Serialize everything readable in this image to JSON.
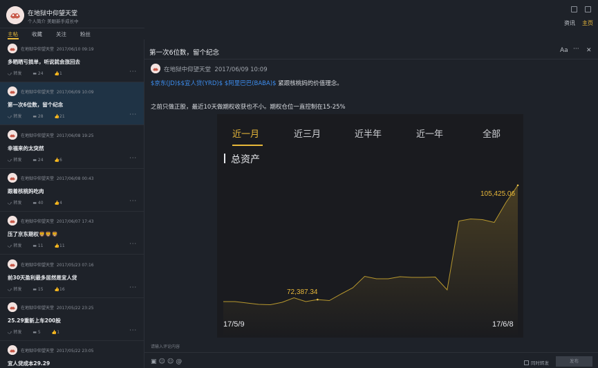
{
  "header": {
    "username": "在地狱中仰望天堂",
    "bio": "个人简介 美眼新手成长中",
    "tabs": [
      {
        "label": "资讯",
        "active": false
      },
      {
        "label": "主页",
        "active": true
      }
    ]
  },
  "nav": {
    "tabs": [
      {
        "label": "主帖",
        "active": true
      },
      {
        "label": "收藏",
        "active": false
      },
      {
        "label": "关注",
        "active": false
      },
      {
        "label": "粉丝",
        "active": false
      }
    ]
  },
  "feed": [
    {
      "author": "在地狱中仰望天堂",
      "time": "2017/06/10 09:19",
      "title": "多晒晒亏损单，听说就会涨回去",
      "repost": "转发",
      "comments": "24",
      "likes": "1",
      "selected": false
    },
    {
      "author": "在地狱中仰望天堂",
      "time": "2017/06/09 10:09",
      "title": "第一次6位数，留个纪念",
      "repost": "转发",
      "comments": "28",
      "likes": "21",
      "selected": true
    },
    {
      "author": "在地狱中仰望天堂",
      "time": "2017/06/08 19:25",
      "title": "幸福来的太突然",
      "repost": "转发",
      "comments": "24",
      "likes": "6",
      "selected": false
    },
    {
      "author": "在地狱中仰望天堂",
      "time": "2017/06/08 00:43",
      "title": "跟着核桃妈吃肉",
      "repost": "转发",
      "comments": "40",
      "likes": "4",
      "selected": false
    },
    {
      "author": "在地狱中仰望天堂",
      "time": "2017/06/07 17:43",
      "title": "压了京东期权🦁🦁🦁",
      "repost": "转发",
      "comments": "11",
      "likes": "11",
      "selected": false
    },
    {
      "author": "在地狱中仰望天堂",
      "time": "2017/05/23 07:16",
      "title": "前30天盈利最多居然是宜人贷",
      "repost": "转发",
      "comments": "15",
      "likes": "16",
      "selected": false
    },
    {
      "author": "在地狱中仰望天堂",
      "time": "2017/05/22 23:25",
      "title": "25.29重新上车200股",
      "repost": "转发",
      "comments": "5",
      "likes": "1",
      "selected": false
    },
    {
      "author": "在地狱中仰望天堂",
      "time": "2017/05/22 23:05",
      "title": "宜人贷成本29.29",
      "repost": "转发",
      "comments": "",
      "likes": "",
      "selected": false
    }
  ],
  "detail": {
    "title": "第一次6位数，留个纪念",
    "font_button": "Aa",
    "more_button": "···",
    "close_button": "✕",
    "author": "在地狱中仰望天堂",
    "time": "2017/06/09 10:09",
    "link1": "$京东(JD)$",
    "link2": "$宜人贷(YRD)$",
    "link3": "$阿里巴巴(BABA)$",
    "line1_rest": " 紧跟核桃妈的价值理念。",
    "line2": "之前只做正股，最近10天做期权收获也不小。期权仓位一直控制在15-25%",
    "comment_placeholder": "请输入评论内容",
    "repost_label": "同时转发",
    "send_label": "发布",
    "tool_icons": [
      "image-icon",
      "emoji-icon",
      "emoji-icon",
      "at-icon"
    ]
  },
  "embedded": {
    "tabs": [
      {
        "label": "近一月",
        "active": true
      },
      {
        "label": "近三月",
        "active": false
      },
      {
        "label": "近半年",
        "active": false
      },
      {
        "label": "近一年",
        "active": false
      },
      {
        "label": "全部",
        "active": false
      }
    ],
    "section_title": "总资产",
    "start_date": "17/5/9",
    "end_date": "17/6/8",
    "min_label": "72,387.34",
    "max_label": "105,425.06"
  },
  "chart_data": {
    "type": "area",
    "title": "总资产",
    "x": [
      "17/5/9",
      "17/6/8"
    ],
    "series": [
      {
        "values": [
          71800,
          71800,
          71400,
          71000,
          70900,
          71600,
          72900,
          71800,
          72387.34,
          72100,
          74000,
          75800,
          79100,
          78400,
          78400,
          79000,
          78800,
          78800,
          78900,
          75200,
          95100,
          95700,
          95500,
          94700,
          100500,
          105425.06
        ]
      }
    ],
    "min_label": "72,387.34",
    "max_label": "105,425.06",
    "colors": {
      "line": "#c9a533",
      "fill": "#3a3220",
      "accent": "#e8b83a"
    }
  }
}
